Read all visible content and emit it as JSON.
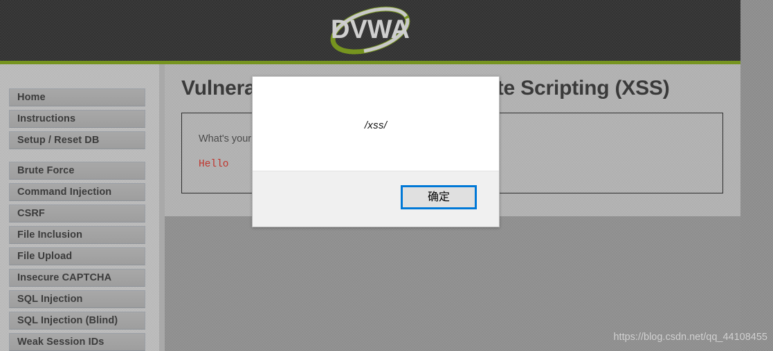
{
  "header": {
    "logo_text": "DVWA",
    "logo_alt": "dvwa-logo",
    "accent_green": "#76941f",
    "header_bg": "#333333"
  },
  "sidebar": {
    "groups": [
      {
        "items": [
          {
            "label": "Home"
          },
          {
            "label": "Instructions"
          },
          {
            "label": "Setup / Reset DB"
          }
        ]
      },
      {
        "items": [
          {
            "label": "Brute Force"
          },
          {
            "label": "Command Injection"
          },
          {
            "label": "CSRF"
          },
          {
            "label": "File Inclusion"
          },
          {
            "label": "File Upload"
          },
          {
            "label": "Insecure CAPTCHA"
          },
          {
            "label": "SQL Injection"
          },
          {
            "label": "SQL Injection (Blind)"
          },
          {
            "label": "Weak Session IDs"
          }
        ]
      }
    ]
  },
  "main": {
    "page_title": "Vulnerability: Reflected Cross Site Scripting (XSS)",
    "prompt_label": "What's your name?",
    "xss_output": "Hello",
    "output_color": "#c0342c"
  },
  "dialog": {
    "message": "/xss/",
    "ok_label": "确定",
    "focus_ring_color": "#0078d7",
    "body_bg": "#ffffff",
    "footer_bg": "#f0f0f0"
  },
  "watermark": {
    "text": "https://blog.csdn.net/qq_44108455"
  }
}
